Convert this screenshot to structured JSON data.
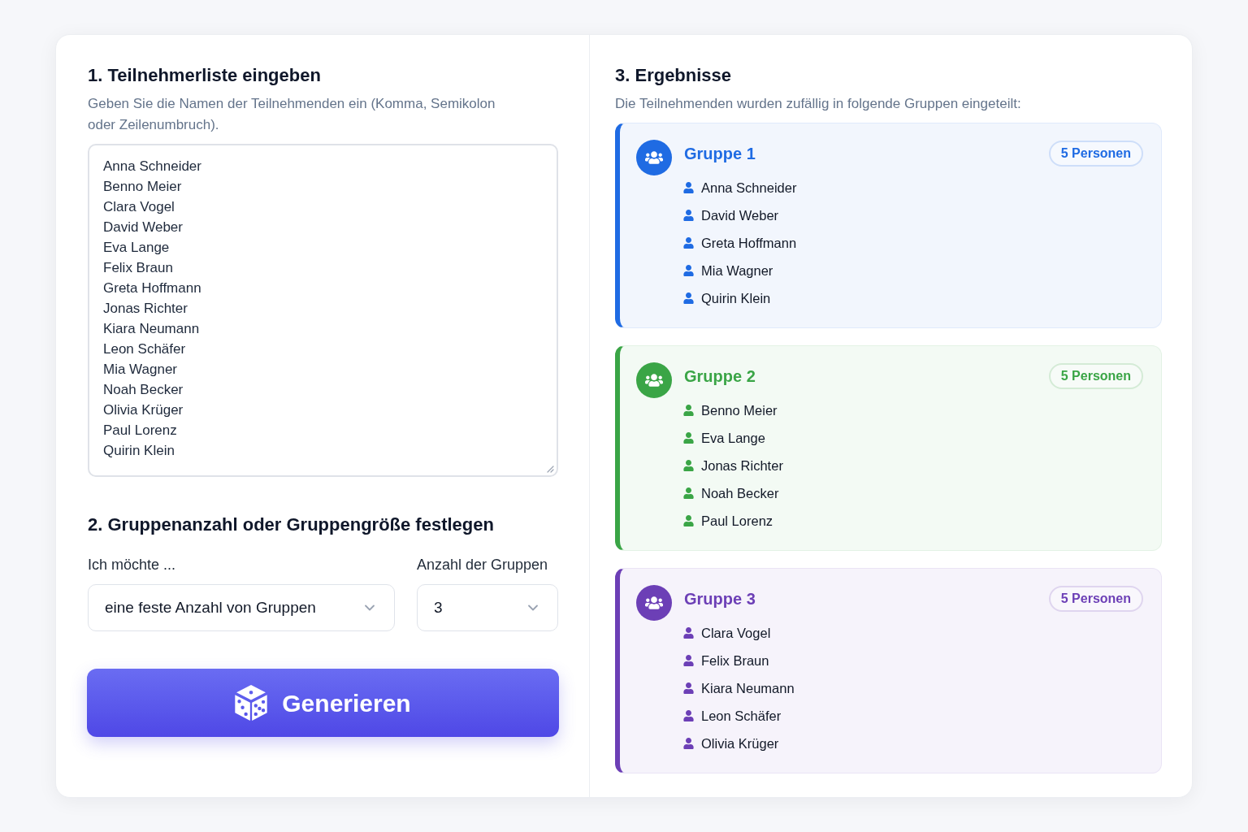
{
  "input_section": {
    "title": "1. Teilnehmerliste eingeben",
    "description": "Geben Sie die Namen der Teilnehmenden ein (Komma, Semikolon oder Zeilenumbruch).",
    "participants": [
      "Anna Schneider",
      "Benno Meier",
      "Clara Vogel",
      "David Weber",
      "Eva Lange",
      "Felix Braun",
      "Greta Hoffmann",
      "Jonas Richter",
      "Kiara Neumann",
      "Leon Schäfer",
      "Mia Wagner",
      "Noah Becker",
      "Olivia Krüger",
      "Paul Lorenz",
      "Quirin Klein"
    ]
  },
  "settings_section": {
    "title": "2. Gruppenanzahl oder Gruppengröße festlegen",
    "mode": {
      "label": "Ich möchte ...",
      "value": "eine feste Anzahl von Gruppen"
    },
    "count": {
      "label": "Anzahl der Gruppen",
      "value": "3"
    }
  },
  "generate_button": {
    "label": "Generieren"
  },
  "results_section": {
    "title": "3. Ergebnisse",
    "description": "Die Teilnehmenden wurden zufällig in folgende Gruppen eingeteilt:",
    "groups": [
      {
        "title": "Gruppe 1",
        "badge": "5 Personen",
        "color": "#1f6be3",
        "members": [
          "Anna Schneider",
          "David Weber",
          "Greta Hoffmann",
          "Mia Wagner",
          "Quirin Klein"
        ]
      },
      {
        "title": "Gruppe 2",
        "badge": "5 Personen",
        "color": "#3aa546",
        "members": [
          "Benno Meier",
          "Eva Lange",
          "Jonas Richter",
          "Noah Becker",
          "Paul Lorenz"
        ]
      },
      {
        "title": "Gruppe 3",
        "badge": "5 Personen",
        "color": "#6c3fb6",
        "members": [
          "Clara Vogel",
          "Felix Braun",
          "Kiara Neumann",
          "Leon Schäfer",
          "Olivia Krüger"
        ]
      }
    ]
  }
}
